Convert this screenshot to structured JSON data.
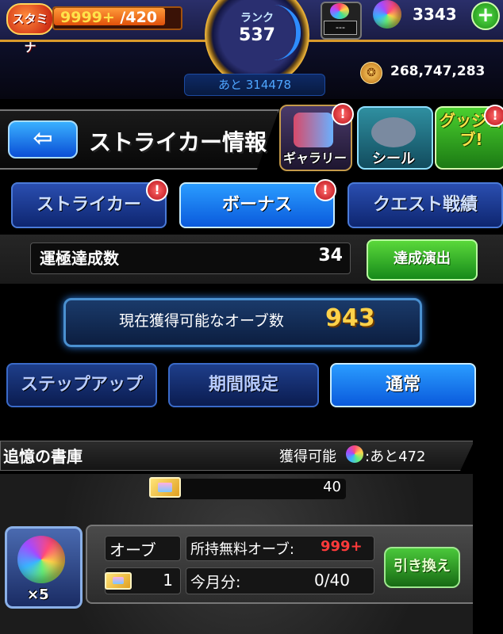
{
  "status": {
    "stamina_label": "スタミナ",
    "stamina_value": "9999+",
    "stamina_max": " /420",
    "rank_label": "ランク",
    "rank_value": "537",
    "next_rank": "あと 314478",
    "tv_label": "---",
    "orb_count": "3343",
    "plus_label": "+",
    "coin_count": "268,747,283"
  },
  "header": {
    "back_label": "⇦",
    "title": "ストライカー情報",
    "gallery_label": "ギャラリー",
    "seal_label": "シール",
    "good_job_label": "グッジョブ!",
    "alert": "!"
  },
  "tabs": [
    {
      "label": "ストライカー",
      "alert": "!"
    },
    {
      "label": "ボーナス",
      "alert": "!"
    },
    {
      "label": "クエスト戦績"
    }
  ],
  "achievement": {
    "label": "運極達成数",
    "value": "34",
    "button": "達成演出"
  },
  "orb_available": {
    "label": "現在獲得可能なオーブ数",
    "value": "943"
  },
  "sub_tabs": [
    {
      "label": "ステップアップ"
    },
    {
      "label": "期間限定"
    },
    {
      "label": "通常"
    }
  ],
  "archive": {
    "title": "追憶の書庫",
    "available_label": "獲得可能",
    "remaining": ":あと472",
    "ticket_value": "40",
    "orb_multiplier": "×5",
    "orb_label": "オーブ",
    "ticket_count": "1",
    "free_orbs_label": "所持無料オーブ:",
    "free_orbs_value": "999+",
    "this_month_label": "今月分:",
    "this_month_value": "0/40",
    "exchange_button": "引き換え"
  }
}
